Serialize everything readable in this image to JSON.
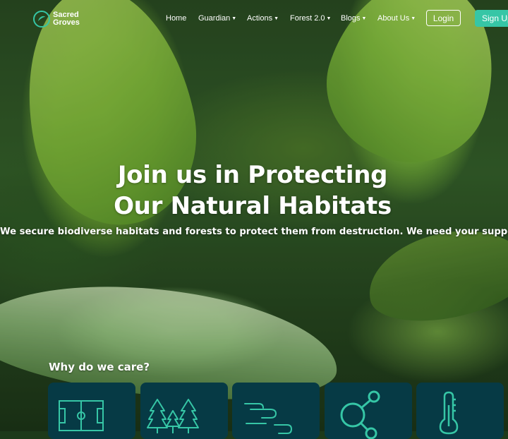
{
  "brand": {
    "name_line1": "Sacred",
    "name_line2": "Groves",
    "accent": "#36c6a6"
  },
  "nav": {
    "items": [
      {
        "label": "Home",
        "has_caret": false
      },
      {
        "label": "Guardian",
        "has_caret": true
      },
      {
        "label": "Actions",
        "has_caret": true
      },
      {
        "label": "Forest 2.0",
        "has_caret": true
      },
      {
        "label": "Blogs",
        "has_caret": true
      },
      {
        "label": "About Us",
        "has_caret": true
      }
    ],
    "login_label": "Login",
    "signup_label": "Sign Up"
  },
  "hero": {
    "headline_line1": "Join us in Protecting",
    "headline_line2": "Our Natural Habitats",
    "subheadline": "We secure biodiverse habitats and forests to protect them from destruction. We need your support!"
  },
  "why": {
    "title": "Why do we care?",
    "cards": [
      {
        "icon": "field-icon"
      },
      {
        "icon": "trees-icon"
      },
      {
        "icon": "clouds-icon"
      },
      {
        "icon": "network-icon"
      },
      {
        "icon": "thermometer-icon"
      }
    ],
    "card_color": "#063a45",
    "icon_color": "#36c6a6"
  }
}
